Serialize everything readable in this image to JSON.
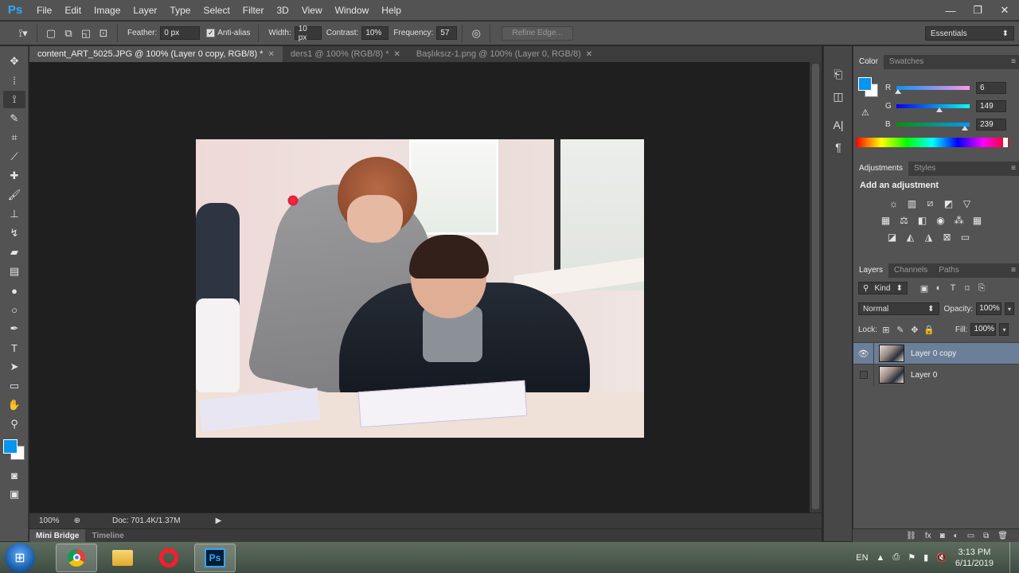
{
  "app": {
    "logo": "Ps"
  },
  "menu": [
    "File",
    "Edit",
    "Image",
    "Layer",
    "Type",
    "Select",
    "Filter",
    "3D",
    "View",
    "Window",
    "Help"
  ],
  "window_controls": {
    "minimize": "—",
    "restore": "❐",
    "close": "✕"
  },
  "options": {
    "feather_label": "Feather:",
    "feather_value": "0 px",
    "antialias_label": "Anti-alias",
    "antialias_checked": true,
    "width_label": "Width:",
    "width_value": "10 px",
    "contrast_label": "Contrast:",
    "contrast_value": "10%",
    "frequency_label": "Frequency:",
    "frequency_value": "57",
    "refine_edge": "Refine Edge...",
    "workspace": "Essentials"
  },
  "doc_tabs": [
    {
      "label": "content_ART_5025.JPG @ 100% (Layer 0 copy, RGB/8) *",
      "active": true
    },
    {
      "label": "ders1 @ 100% (RGB/8) *",
      "active": false
    },
    {
      "label": "Başlıksız-1.png @ 100% (Layer 0, RGB/8)",
      "active": false
    }
  ],
  "status": {
    "zoom": "100%",
    "doc": "Doc: 701.4K/1.37M"
  },
  "bottom_tabs": [
    "Mini Bridge",
    "Timeline"
  ],
  "colors": {
    "foreground": "#0695ef",
    "background": "#ffffff"
  },
  "color_panel": {
    "tabs": [
      "Color",
      "Swatches"
    ],
    "r_label": "R",
    "r_value": "6",
    "g_label": "G",
    "g_value": "149",
    "b_label": "B",
    "b_value": "239"
  },
  "adjustments": {
    "tabs": [
      "Adjustments",
      "Styles"
    ],
    "title": "Add an adjustment"
  },
  "layers_panel": {
    "tabs": [
      "Layers",
      "Channels",
      "Paths"
    ],
    "filter_kind": "Kind",
    "blend_mode": "Normal",
    "opacity_label": "Opacity:",
    "opacity_value": "100%",
    "lock_label": "Lock:",
    "fill_label": "Fill:",
    "fill_value": "100%",
    "layers": [
      {
        "name": "Layer 0 copy",
        "visible": true,
        "selected": true
      },
      {
        "name": "Layer 0",
        "visible": false,
        "selected": false
      }
    ]
  },
  "taskbar": {
    "start": "⊞",
    "language": "EN",
    "time": "3:13 PM",
    "date": "6/11/2019"
  }
}
